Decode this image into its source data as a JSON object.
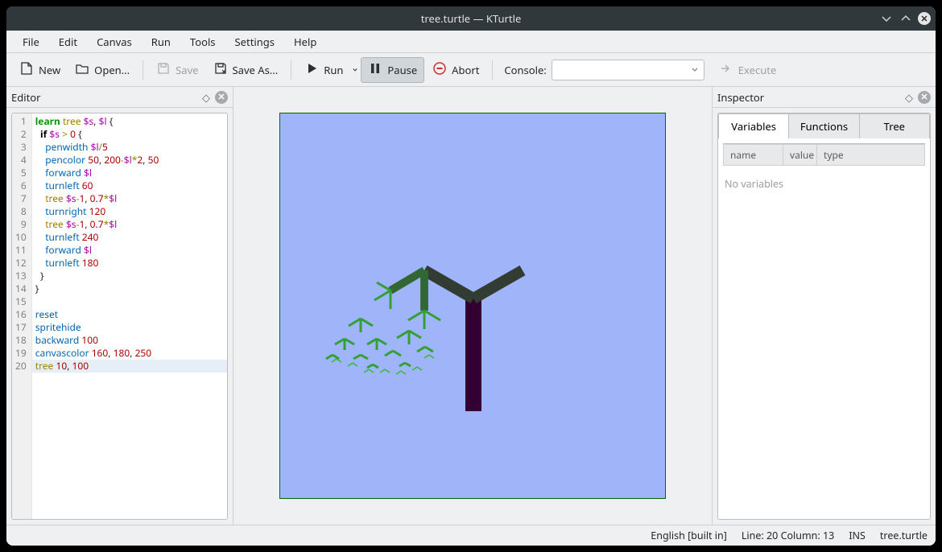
{
  "window": {
    "title": "tree.turtle — KTurtle"
  },
  "menubar": [
    "File",
    "Edit",
    "Canvas",
    "Run",
    "Tools",
    "Settings",
    "Help"
  ],
  "toolbar": {
    "new": "New",
    "open": "Open...",
    "save": "Save",
    "save_as": "Save As...",
    "run": "Run",
    "pause": "Pause",
    "abort": "Abort",
    "console_label": "Console:",
    "execute": "Execute"
  },
  "editor": {
    "title": "Editor",
    "lines": [
      [
        [
          "kw",
          "learn"
        ],
        [
          "",
          " "
        ],
        [
          "call",
          "tree"
        ],
        [
          "",
          " "
        ],
        [
          "var",
          "$s"
        ],
        [
          "punct",
          ","
        ],
        [
          "",
          " "
        ],
        [
          "var",
          "$l"
        ],
        [
          "",
          " "
        ],
        [
          "punct",
          "{"
        ]
      ],
      [
        [
          "",
          "  "
        ],
        [
          "kwbold",
          "if"
        ],
        [
          "",
          " "
        ],
        [
          "var",
          "$s"
        ],
        [
          "",
          " "
        ],
        [
          "op",
          ">"
        ],
        [
          "",
          " "
        ],
        [
          "num",
          "0"
        ],
        [
          "",
          " "
        ],
        [
          "punct",
          "{"
        ]
      ],
      [
        [
          "",
          "    "
        ],
        [
          "cmd",
          "penwidth"
        ],
        [
          "",
          " "
        ],
        [
          "var",
          "$l"
        ],
        [
          "op",
          "/"
        ],
        [
          "num",
          "5"
        ]
      ],
      [
        [
          "",
          "    "
        ],
        [
          "cmd",
          "pencolor"
        ],
        [
          "",
          " "
        ],
        [
          "num",
          "50"
        ],
        [
          "punct",
          ","
        ],
        [
          "",
          " "
        ],
        [
          "num",
          "200"
        ],
        [
          "op",
          "-"
        ],
        [
          "var",
          "$l"
        ],
        [
          "op",
          "*"
        ],
        [
          "num",
          "2"
        ],
        [
          "punct",
          ","
        ],
        [
          "",
          " "
        ],
        [
          "num",
          "50"
        ]
      ],
      [
        [
          "",
          "    "
        ],
        [
          "cmd",
          "forward"
        ],
        [
          "",
          " "
        ],
        [
          "var",
          "$l"
        ]
      ],
      [
        [
          "",
          "    "
        ],
        [
          "cmd",
          "turnleft"
        ],
        [
          "",
          " "
        ],
        [
          "num",
          "60"
        ]
      ],
      [
        [
          "",
          "    "
        ],
        [
          "call",
          "tree"
        ],
        [
          "",
          " "
        ],
        [
          "var",
          "$s"
        ],
        [
          "op",
          "-"
        ],
        [
          "num",
          "1"
        ],
        [
          "punct",
          ","
        ],
        [
          "",
          " "
        ],
        [
          "num",
          "0.7"
        ],
        [
          "op",
          "*"
        ],
        [
          "var",
          "$l"
        ]
      ],
      [
        [
          "",
          "    "
        ],
        [
          "cmd",
          "turnright"
        ],
        [
          "",
          " "
        ],
        [
          "num",
          "120"
        ]
      ],
      [
        [
          "",
          "    "
        ],
        [
          "call",
          "tree"
        ],
        [
          "",
          " "
        ],
        [
          "var",
          "$s"
        ],
        [
          "op",
          "-"
        ],
        [
          "num",
          "1"
        ],
        [
          "punct",
          ","
        ],
        [
          "",
          " "
        ],
        [
          "num",
          "0.7"
        ],
        [
          "op",
          "*"
        ],
        [
          "var",
          "$l"
        ]
      ],
      [
        [
          "",
          "    "
        ],
        [
          "cmd",
          "turnleft"
        ],
        [
          "",
          " "
        ],
        [
          "num",
          "240"
        ]
      ],
      [
        [
          "",
          "    "
        ],
        [
          "cmd",
          "forward"
        ],
        [
          "",
          " "
        ],
        [
          "var",
          "$l"
        ]
      ],
      [
        [
          "",
          "    "
        ],
        [
          "cmd",
          "turnleft"
        ],
        [
          "",
          " "
        ],
        [
          "num",
          "180"
        ]
      ],
      [
        [
          "",
          "  "
        ],
        [
          "punct",
          "}"
        ]
      ],
      [
        [
          "punct",
          "}"
        ]
      ],
      [
        [
          "",
          ""
        ]
      ],
      [
        [
          "cmd",
          "reset"
        ]
      ],
      [
        [
          "cmd",
          "spritehide"
        ]
      ],
      [
        [
          "cmd",
          "backward"
        ],
        [
          "",
          " "
        ],
        [
          "num",
          "100"
        ]
      ],
      [
        [
          "cmd",
          "canvascolor"
        ],
        [
          "",
          " "
        ],
        [
          "num",
          "160"
        ],
        [
          "punct",
          ","
        ],
        [
          "",
          " "
        ],
        [
          "num",
          "180"
        ],
        [
          "punct",
          ","
        ],
        [
          "",
          " "
        ],
        [
          "num",
          "250"
        ]
      ],
      [
        [
          "call",
          "tree"
        ],
        [
          "",
          " "
        ],
        [
          "num",
          "10"
        ],
        [
          "punct",
          ","
        ],
        [
          "",
          " "
        ],
        [
          "num",
          "100"
        ]
      ]
    ],
    "highlight_line": 20
  },
  "inspector": {
    "title": "Inspector",
    "tabs": [
      "Variables",
      "Functions",
      "Tree"
    ],
    "active_tab": 0,
    "columns": [
      "name",
      "value",
      "type"
    ],
    "empty_text": "No variables"
  },
  "statusbar": {
    "language": "English [built in]",
    "position": "Line: 20 Column: 13",
    "mode": "INS",
    "file": "tree.turtle"
  }
}
